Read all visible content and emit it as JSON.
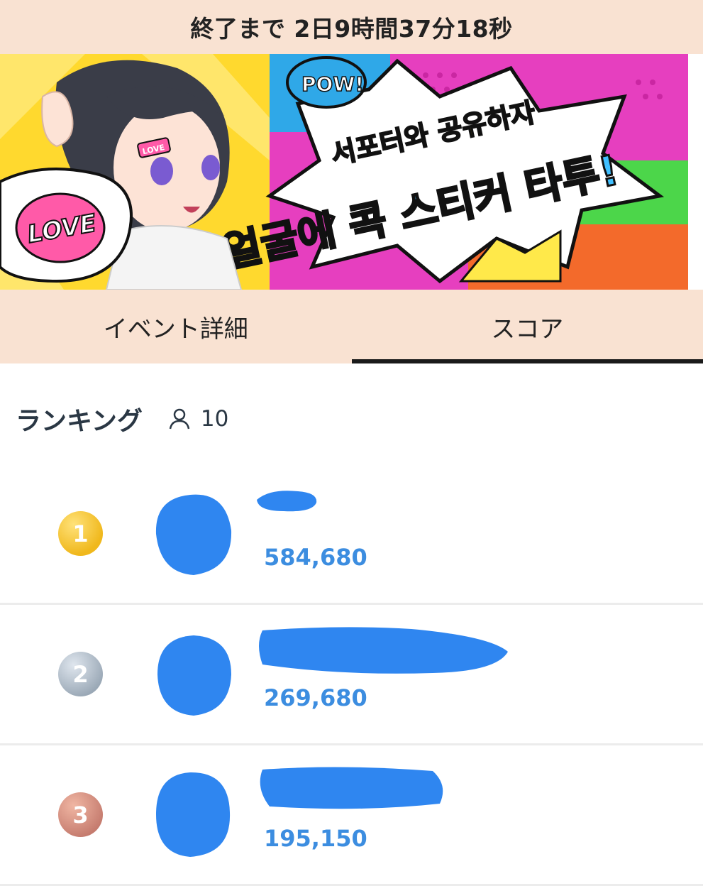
{
  "header": {
    "countdown": "終了まで 2日9時間37分18秒"
  },
  "banner": {
    "line1": "서포터와 공유하자",
    "line2": "얼굴에 콕 스티커 타투!",
    "love": "LOVE",
    "pow": "POW!",
    "cheek": "LOVE"
  },
  "tabs": [
    {
      "label": "イベント詳細",
      "active": false
    },
    {
      "label": "スコア",
      "active": true
    }
  ],
  "ranking": {
    "title": "ランキング",
    "participant_count": "10",
    "items": [
      {
        "rank": "1",
        "score": "584,680"
      },
      {
        "rank": "2",
        "score": "269,680"
      },
      {
        "rank": "3",
        "score": "195,150"
      }
    ]
  },
  "colors": {
    "accent": "#3c8de0",
    "tab_bg": "#f9e2d2",
    "redaction": "#2f86f0"
  }
}
